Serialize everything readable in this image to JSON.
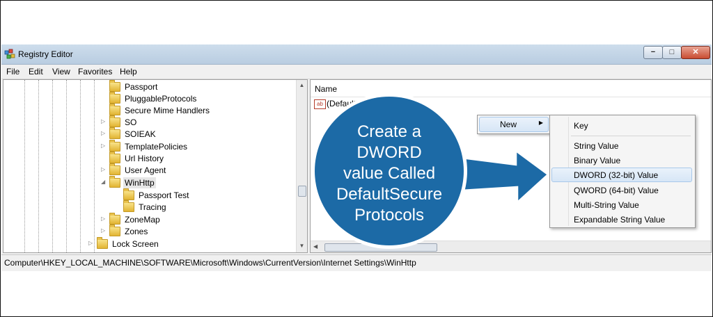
{
  "window": {
    "title": "Registry Editor",
    "caption_buttons": {
      "minimize": "−",
      "maximize": "□",
      "close": "✕"
    }
  },
  "menu": [
    "File",
    "Edit",
    "View",
    "Favorites",
    "Help"
  ],
  "tree": [
    {
      "label": "Passport",
      "expandable": false,
      "selected": false
    },
    {
      "label": "PluggableProtocols",
      "expandable": false,
      "selected": false
    },
    {
      "label": "Secure Mime Handlers",
      "expandable": false,
      "selected": false
    },
    {
      "label": "SO",
      "expandable": true,
      "selected": false
    },
    {
      "label": "SOIEAK",
      "expandable": true,
      "selected": false
    },
    {
      "label": "TemplatePolicies",
      "expandable": true,
      "selected": false
    },
    {
      "label": "Url History",
      "expandable": false,
      "selected": false
    },
    {
      "label": "User Agent",
      "expandable": true,
      "selected": false
    },
    {
      "label": "WinHttp",
      "expandable": true,
      "expanded": true,
      "selected": true
    },
    {
      "label": "Passport Test",
      "expandable": false,
      "selected": false,
      "child": true
    },
    {
      "label": "Tracing",
      "expandable": false,
      "selected": false,
      "child": true
    },
    {
      "label": "ZoneMap",
      "expandable": true,
      "selected": false
    },
    {
      "label": "Zones",
      "expandable": true,
      "selected": false
    },
    {
      "label": "Lock Screen",
      "expandable": true,
      "selected": false,
      "parent_level": true
    }
  ],
  "list": {
    "column_header": "Name",
    "rows": [
      {
        "icon": "ab",
        "name": "(Default)"
      }
    ]
  },
  "context_menu": {
    "item": "New",
    "arrow": "▶"
  },
  "submenu": {
    "items": [
      {
        "label": "Key",
        "highlighted": false
      },
      {
        "label": "String Value",
        "highlighted": false
      },
      {
        "label": "Binary Value",
        "highlighted": false
      },
      {
        "label": "DWORD (32-bit) Value",
        "highlighted": true
      },
      {
        "label": "QWORD (64-bit) Value",
        "highlighted": false
      },
      {
        "label": "Multi-String Value",
        "highlighted": false
      },
      {
        "label": "Expandable String Value",
        "highlighted": false
      }
    ]
  },
  "status_path": "Computer\\HKEY_LOCAL_MACHINE\\SOFTWARE\\Microsoft\\Windows\\CurrentVersion\\Internet Settings\\WinHttp",
  "callout": {
    "lines": [
      "Create a",
      "DWORD",
      "value Called",
      "DefaultSecure",
      "Protocols"
    ],
    "color": "#1c6aa6"
  },
  "colors": {
    "selection": "#cce4f7",
    "callout_blue": "#1c6aa6"
  }
}
